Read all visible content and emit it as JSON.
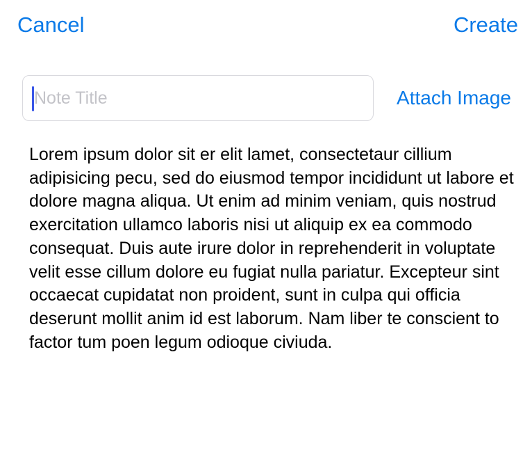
{
  "nav": {
    "cancel_label": "Cancel",
    "create_label": "Create"
  },
  "note": {
    "title_placeholder": "Note Title",
    "title_value": "",
    "attach_label": "Attach Image",
    "body_text": "Lorem ipsum dolor sit er elit lamet, consectetaur cillium adipisicing pecu, sed do eiusmod tempor incididunt ut labore et dolore magna aliqua. Ut enim ad minim veniam, quis nostrud exercitation ullamco laboris nisi ut aliquip ex ea commodo consequat. Duis aute irure dolor in reprehenderit in voluptate velit esse cillum dolore eu fugiat nulla pariatur. Excepteur sint occaecat cupidatat non proident, sunt in culpa qui officia deserunt mollit anim id est laborum. Nam liber te conscient to factor tum poen legum odioque civiuda."
  },
  "colors": {
    "accent": "#0a7ae8",
    "caret": "#3a57e8",
    "placeholder": "#c3c3c8",
    "field_border": "#d9d9de"
  }
}
